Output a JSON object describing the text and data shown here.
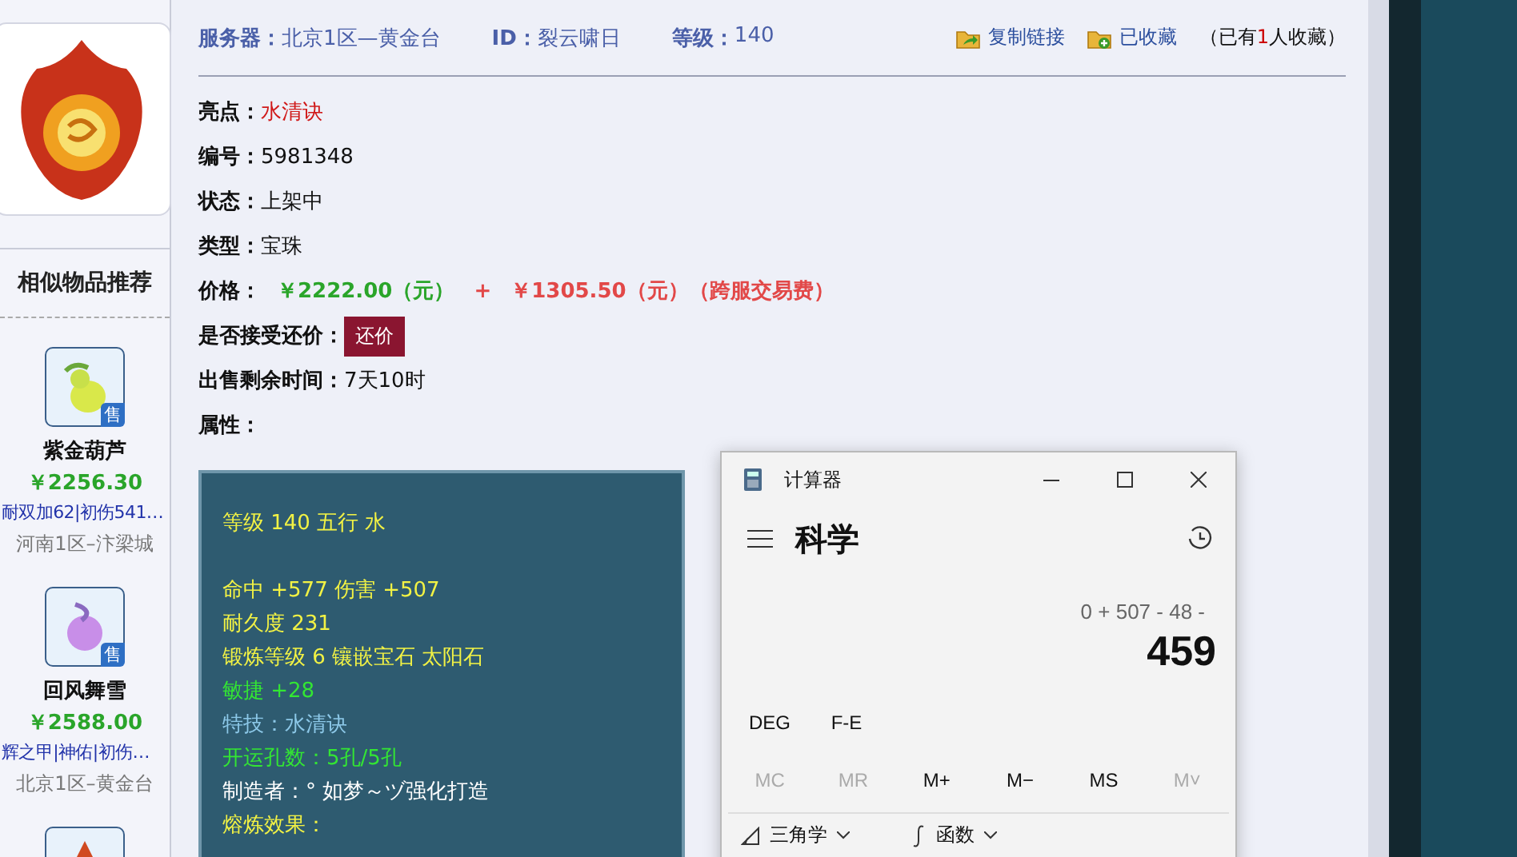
{
  "header": {
    "fields": [
      {
        "label": "服务器：",
        "value": "北京1区—黄金台"
      },
      {
        "label": "ID：",
        "value": "裂云啸日"
      },
      {
        "label": "等级：",
        "value": "140"
      }
    ],
    "actions": [
      {
        "kind": "share",
        "label": "复制链接"
      },
      {
        "kind": "saved",
        "label": "已收藏"
      }
    ],
    "favorites_note": {
      "before": "（已有",
      "count": "1",
      "after": "人收藏）"
    }
  },
  "details": [
    {
      "label": "亮点：",
      "value": "水清诀",
      "kind": "highlight"
    },
    {
      "label": "编号：",
      "value": "5981348",
      "kind": "plain"
    },
    {
      "label": "状态：",
      "value": "上架中",
      "kind": "plain"
    },
    {
      "label": "类型：",
      "value": "宝珠",
      "kind": "plain"
    }
  ],
  "price": {
    "label": "价格：",
    "base": "￥2222.00（元）",
    "plus": "+",
    "fee": "￥1305.50（元）（跨服交易费）"
  },
  "bargain": {
    "label": "是否接受还价：",
    "button": "还价"
  },
  "remaining": {
    "label": "出售剩余时间：",
    "value": "7天10时"
  },
  "attributes_label": "属性：",
  "attribute_groups": [
    {
      "lines": [
        {
          "kind": "yellow",
          "text": "等级 140 五行 水"
        }
      ]
    },
    {
      "lines": [
        {
          "kind": "yellow",
          "text": "命中 +577 伤害 +507"
        },
        {
          "kind": "yellow",
          "text": "耐久度 231"
        },
        {
          "kind": "yellow",
          "text": "锻炼等级 6 镶嵌宝石 太阳石"
        },
        {
          "kind": "green",
          "text": "敏捷 +28"
        },
        {
          "kind": "skill",
          "text": "特技：水清诀"
        },
        {
          "kind": "green",
          "text": "开运孔数：5孔/5孔"
        },
        {
          "kind": "white",
          "text": "制造者：° 如梦～ヅ强化打造"
        },
        {
          "kind": "yellow",
          "text": "熔炼效果："
        }
      ]
    }
  ],
  "sidebar": {
    "title": "相似物品推荐",
    "items": [
      {
        "kind": "gourd",
        "badge": "售",
        "name": "紫金葫芦",
        "price": "￥2256.30",
        "desc": "耐双加62|初伤541…",
        "server": "河南1区–汴梁城"
      },
      {
        "kind": "orb",
        "badge": "售",
        "name": "回风舞雪",
        "price": "￥2588.00",
        "desc": "辉之甲|神佑|初伤…",
        "server": "北京1区–黄金台"
      },
      {
        "kind": "flame"
      }
    ]
  },
  "calculator": {
    "title": "计算器",
    "mode": "科学",
    "expression": "0 + 507 - 48 -",
    "result": "459",
    "options": [
      "DEG",
      "F-E"
    ],
    "memory": [
      {
        "label": "MC",
        "disabled": true
      },
      {
        "label": "MR",
        "disabled": true
      },
      {
        "label": "M+",
        "disabled": false
      },
      {
        "label": "M−",
        "disabled": false
      },
      {
        "label": "MS",
        "disabled": false
      },
      {
        "label": "M˅",
        "disabled": true
      }
    ],
    "menus": [
      {
        "kind": "trig",
        "label": "三角学"
      },
      {
        "kind": "func",
        "label": "函数"
      }
    ]
  }
}
